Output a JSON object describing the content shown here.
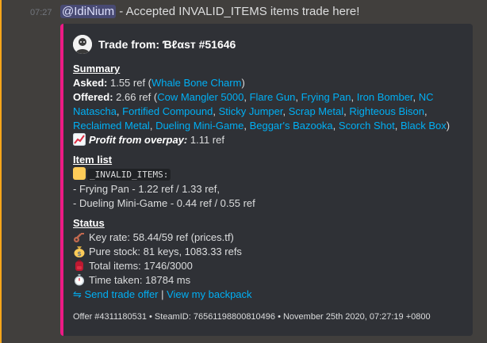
{
  "message": {
    "time": "07:27",
    "mention": "@IdiNium",
    "text": " - Accepted INVALID_ITEMS items trade here!"
  },
  "embed": {
    "accent_color": "#ec1a85",
    "author": "Trade from: Ɓℓαѕт #51646",
    "summary": {
      "title": "Summary",
      "asked_label": "Asked:",
      "asked_value": " 1.55 ref (",
      "asked_item": "Whale Bone Charm",
      "asked_close": ")",
      "offered_label": "Offered:",
      "offered_value": " 2.66 ref (",
      "offered_items": [
        "Cow Mangler 5000",
        "Flare Gun",
        "Frying Pan",
        "Iron Bomber",
        "NC Natascha",
        "Fortified Compound",
        "Sticky Jumper",
        "Scrap Metal",
        "Righteous Bison",
        "Reclaimed Metal",
        "Dueling Mini-Game",
        "Beggar's Bazooka",
        "Scorch Shot",
        "Black Box"
      ],
      "profit_label": "Profit from overpay:",
      "profit_value": " 1.11 ref"
    },
    "item_list": {
      "title": "Item list",
      "code": "_INVALID_ITEMS:",
      "items": [
        "- Frying Pan - 1.22 ref / 1.33 ref,",
        "- Dueling Mini-Game - 0.44 ref / 0.55 ref"
      ]
    },
    "status": {
      "title": "Status",
      "key_rate": "Key rate: 58.44/59 ref (prices.tf)",
      "pure_stock": "Pure stock: 81 keys, 1083.33 refs",
      "total_items": "Total items: 1746/3000",
      "time_taken": "Time taken: 18784 ms",
      "send_offer": "⇋ Send trade offer",
      "separator": " | ",
      "view_backpack": "View my backpack"
    },
    "footer": "Offer #4311180531 • SteamID: 76561198800810496 • November 25th 2020, 07:27:19 +0800"
  }
}
